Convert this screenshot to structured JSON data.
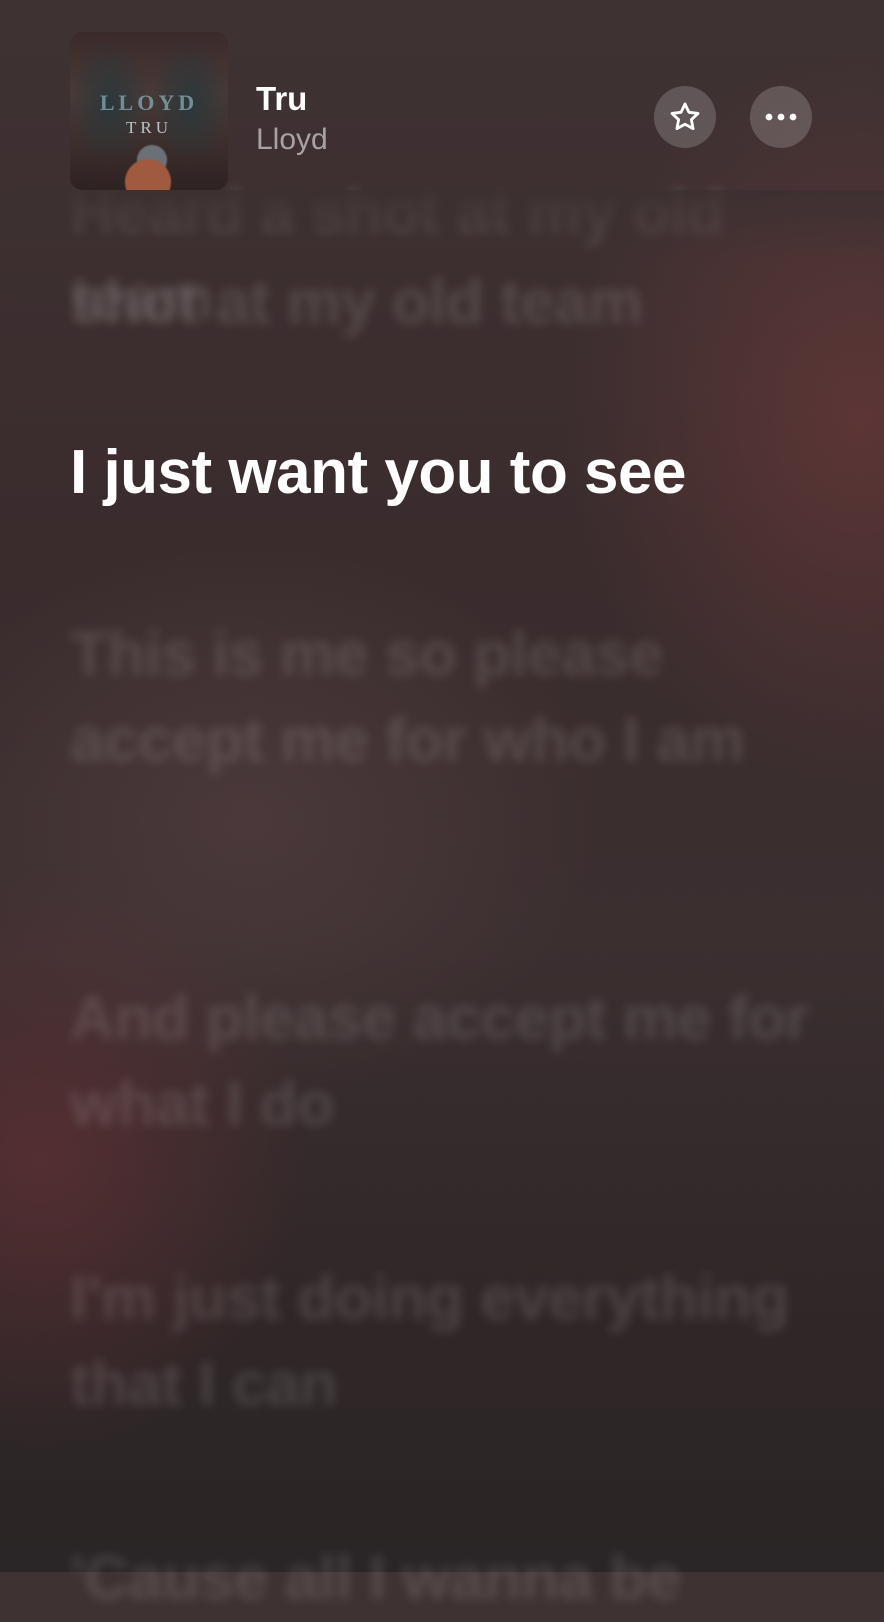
{
  "now_playing": {
    "title": "Tru",
    "artist": "Lloyd",
    "cover_art": {
      "artist_text": "LLOYD",
      "title_text": "TRU"
    }
  },
  "actions": {
    "favorite_icon": "star-icon",
    "more_icon": "ellipsis-icon"
  },
  "lyrics": {
    "previous_partial": "Heard a shot at my old team",
    "previous_line": "shot at my old team",
    "current_line": "I just want you to see",
    "next_lines": [
      "This is me so please accept me for who I am",
      "And please accept me for what I do",
      "I'm just doing everything that I can",
      "'Cause all I wanna be"
    ]
  }
}
